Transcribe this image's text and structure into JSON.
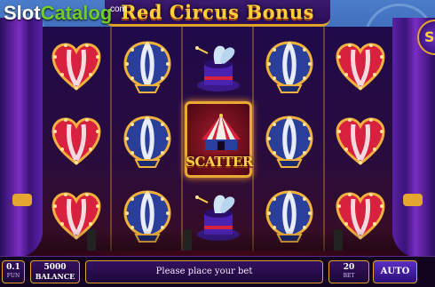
{
  "logo": {
    "part1": "Slot",
    "part2": "Catalog",
    "suffix": "com"
  },
  "game": {
    "title": "Red Circus Bonus"
  },
  "reels": [
    [
      "heart",
      "heart",
      "heart"
    ],
    [
      "balloon",
      "balloon",
      "balloon"
    ],
    [
      "hat",
      "scatter",
      "hat"
    ],
    [
      "balloon",
      "balloon",
      "balloon"
    ],
    [
      "heart",
      "heart",
      "heart"
    ]
  ],
  "scatter": {
    "label": "SCATTER"
  },
  "controls": {
    "fun_value": "0.1",
    "fun_label": "FUN",
    "balance_value": "5000",
    "balance_label": "BALANCE",
    "message": "Please place your bet",
    "bet_value": "20",
    "bet_label": "BET",
    "auto_label": "AUTO",
    "spin_label": "S"
  },
  "colors": {
    "gold": "#e0a12a",
    "purple": "#34115f",
    "heart_red": "#d8213f",
    "balloon_blue": "#2a3f9a"
  }
}
